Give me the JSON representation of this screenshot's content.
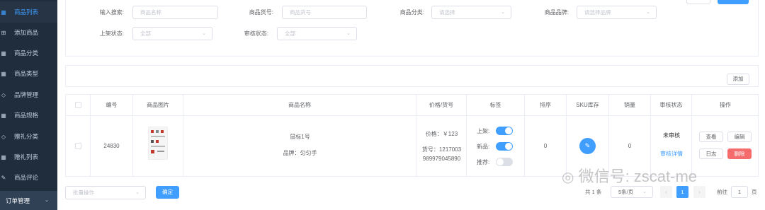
{
  "sidebar": {
    "items": [
      {
        "label": "商品列表",
        "icon": "grid-icon",
        "active": true
      },
      {
        "label": "添加商品",
        "icon": "plus-square-icon"
      },
      {
        "label": "商品分类",
        "icon": "grid-icon"
      },
      {
        "label": "商品类型",
        "icon": "grid-icon"
      },
      {
        "label": "品牌管理",
        "icon": "tag-icon"
      },
      {
        "label": "商品规格",
        "icon": "grid-icon"
      },
      {
        "label": "赠礼分类",
        "icon": "tag-icon"
      },
      {
        "label": "赠礼列表",
        "icon": "grid-icon"
      },
      {
        "label": "商品评论",
        "icon": "edit-icon"
      }
    ],
    "group": {
      "label": "订单管理"
    }
  },
  "filters": {
    "keyword": {
      "label": "输入搜索:",
      "placeholder": "商品名称"
    },
    "sn": {
      "label": "商品货号:",
      "placeholder": "商品货号"
    },
    "category": {
      "label": "商品分类:",
      "placeholder": "请选择"
    },
    "brand": {
      "label": "商品品牌:",
      "placeholder": "请选择品牌"
    },
    "publish": {
      "label": "上架状态:",
      "placeholder": "全部"
    },
    "verify": {
      "label": "审核状态:",
      "placeholder": "全部"
    }
  },
  "toolbar": {
    "add_label": "添加"
  },
  "table": {
    "headers": [
      "编号",
      "商品图片",
      "商品名称",
      "价格/货号",
      "标签",
      "排序",
      "SKU库存",
      "销量",
      "审核状态",
      "操作"
    ],
    "row": {
      "id": "24830",
      "name": "鼠标1号",
      "brand": "品牌：匀匀手",
      "price": "价格：￥123",
      "sn_line1": "货号：1217003",
      "sn_line2": "989979045890",
      "tag_publish": "上架:",
      "tag_new": "新品:",
      "tag_recommend": "推荐:",
      "publish_on": true,
      "new_on": true,
      "recommend_on": false,
      "sort": "0",
      "sales": "0",
      "verify_status": "未审核",
      "verify_detail": "审核详情",
      "ops": {
        "view": "查看",
        "edit": "编辑",
        "log": "日志",
        "delete": "删除"
      }
    }
  },
  "footer": {
    "batch_placeholder": "批量操作",
    "confirm_label": "确定",
    "total": "共 1 条",
    "page_size": "5条/页",
    "current_page": "1",
    "goto_label": "前往",
    "goto_value": "1",
    "page_suffix": "页"
  },
  "watermark": "微信号: zscat-me",
  "colors": {
    "primary": "#409eff",
    "danger": "#f56c6c",
    "sidebar": "#1f2d3d"
  }
}
